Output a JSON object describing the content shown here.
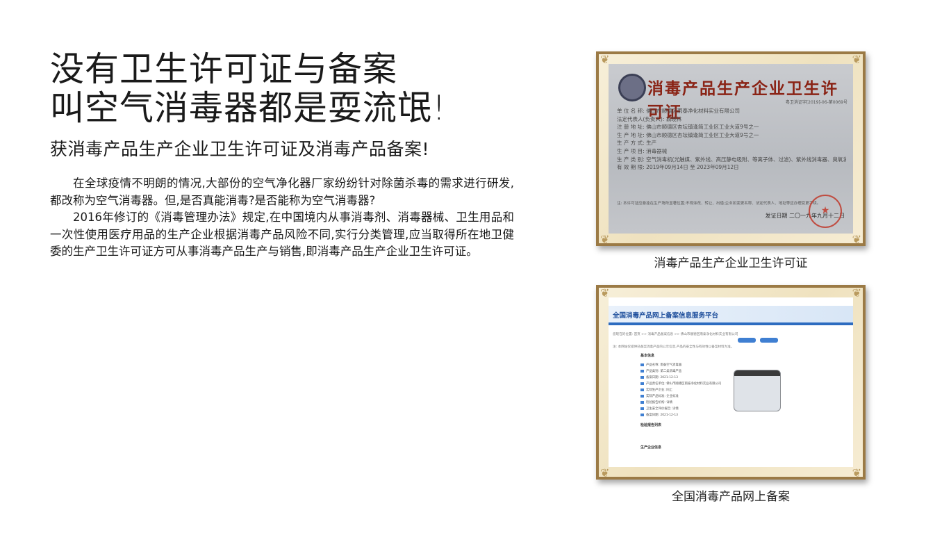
{
  "headline": {
    "line1": "没有卫生许可证与备案",
    "line2": "叫空气消毒器都是耍流氓!"
  },
  "subhead": "获消毒产品生产企业卫生许可证及消毒产品备案!",
  "body": {
    "p1": "在全球疫情不明朗的情况,大部份的空气净化器厂家纷纷针对除菌杀毒的需求进行研发,都改称为空气消毒器。但,是否真能消毒?是否能称为空气消毒器?",
    "p2": "2016年修订的《消毒管理办法》规定,在中国境内从事消毒剂、消毒器械、卫生用品和一次性使用医疗用品的生产企业根据消毒产品风险不同,实行分类管理,应当取得所在地卫健委的生产卫生许可证方可从事消毒产品生产与销售,即消毒产品生产企业卫生许可证。"
  },
  "figures": [
    {
      "caption": "消毒产品生产企业卫生许可证",
      "certificate": {
        "title": "消毒产品生产企业卫生许可证",
        "number": "粤卫消证字[2019]-06-第0069号",
        "lines": [
          "单 位 名 称: 佛山市顺德区雨泰净化材料实业有限公司",
          "法定代表人(负责人): 翁晓林",
          "注 册 地 址: 佛山市顺德区杏坛镇逢简工业区工业大道9号之一",
          "生 产 地 址: 佛山市顺德区杏坛镇逢简工业区工业大道9号之一",
          "生 产 方 式: 生产",
          "生 产 项 目: 消毒器械",
          "生 产 类 别: 空气消毒机(光触媒、紫外线、高压静电吸附、等离子体、过滤)、紫外线消毒器、臭氧发生器",
          "有 效 期 限: 2019年09月14日 至 2023年09月12日"
        ],
        "note": "注: 本许可证应悬挂在生产场所显著位置;不得涂改、转让、出借;企业如变更名称、法定代表人、地址等应办理变更手续。",
        "date": "发证日期 二〇一九年九月十二日",
        "stamp": "★"
      }
    },
    {
      "caption": "全国消毒产品网上备案",
      "website": {
        "title": "全国消毒产品网上备案信息服务平台",
        "breadcrumb": "您现在的位置: 首页 >> 消毒产品备案信息 >> 佛山市顺德区雨泰净化材料实业有限公司",
        "notice": "注: 本网站仅提供已备案消毒产品的公示信息,产品的安全性与有效性以备案材料为准。",
        "section_basic": "基本信息",
        "rows": [
          "产品名称: 雨泰空气消毒器",
          "产品类别: 第二类消毒产品",
          "备案日期: 2021-12-13",
          "产品责任单位: 佛山市顺德区雨泰净化材料实业有限公司",
          "实际生产企业: 同上",
          "实际产品标准: 企业标准",
          "检验报告机构: 详情",
          "卫生安全评价报告: 详情",
          "备案日期: 2021-12-13"
        ],
        "section_report": "检验报告列表",
        "section_company": "生产企业信息",
        "button_1": "",
        "button_2": ""
      }
    }
  ]
}
